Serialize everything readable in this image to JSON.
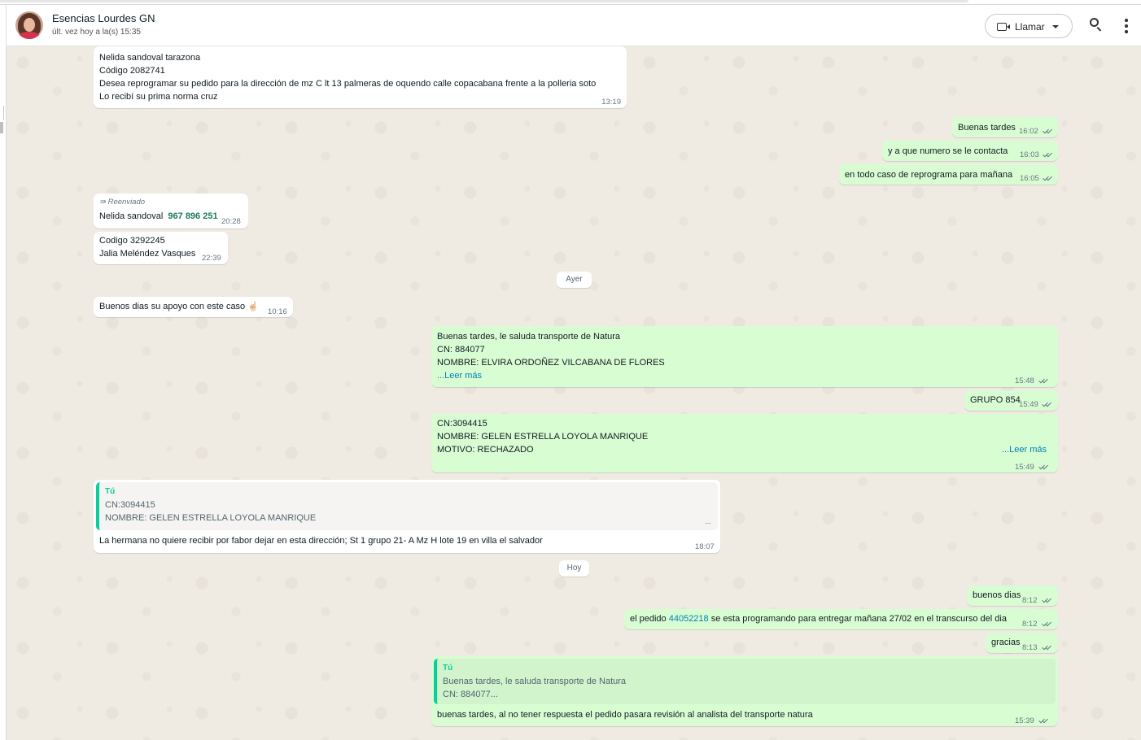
{
  "header": {
    "contact_name": "Esencias Lourdes GN",
    "status": "últ. vez hoy a la(s) 15:35",
    "call_label": "Llamar",
    "icons": [
      "video-icon",
      "chevron-down-icon",
      "search-icon",
      "menu-icon"
    ]
  },
  "messages": [
    {
      "dir": "in",
      "lines": [
        "Nelida sandoval tarazona",
        "Código 2082741",
        "Desea reprogramar su pedido para la dirección de  mz C lt 13 palmeras de oquendo calle copacabana frente a la polleria soto",
        "Lo recibí su prima norma cruz"
      ],
      "time": "13:19"
    },
    {
      "dir": "out",
      "text": "Buenas tardes",
      "time": "16:02"
    },
    {
      "dir": "out",
      "text": "y  a que numero  se le contacta",
      "time": "16:03"
    },
    {
      "dir": "out",
      "text": "en todo caso de reprograma para mañana",
      "time": "16:05"
    },
    {
      "dir": "in",
      "forwarded": "Reenviado",
      "text": "Nelida sandoval",
      "phone": "967 896 251",
      "time": "20:28"
    },
    {
      "dir": "in",
      "lines": [
        "Codigo 3292245",
        "Jalia Meléndez Vasques"
      ],
      "time": "22:39"
    },
    {
      "dir": "in",
      "text": "Buenos dias su apoyo con este caso",
      "emoji": "☝🏻",
      "time": "10:16"
    },
    {
      "dir": "out",
      "lines": [
        "Buenas tardes, le saluda transporte de Natura",
        "CN: 884077",
        "NOMBRE:  ELVIRA ORDOÑEZ VILCABANA DE FLORES"
      ],
      "read_more": "...Leer más",
      "time": "15:48"
    },
    {
      "dir": "out",
      "text": "GRUPO 854",
      "time": "15:49"
    },
    {
      "dir": "out",
      "lines": [
        "CN:3094415",
        "NOMBRE:  GELEN ESTRELLA LOYOLA MANRIQUE",
        "MOTIVO: RECHAZADO"
      ],
      "read_more": "...Leer más",
      "time": "15:49"
    },
    {
      "dir": "in",
      "quote": {
        "author": "Tú",
        "lines": [
          "CN:3094415",
          "NOMBRE:  GELEN ESTRELLA LOYOLA MANRIQUE"
        ],
        "ellipsis": "..."
      },
      "text": "La hermana no quiere recibir por fabor dejar en esta dirección; St 1 grupo 21- A Mz H lote 19 en villa el salvador",
      "time": "18:07"
    },
    {
      "dir": "out",
      "text": "buenos dias",
      "time": "8:12"
    },
    {
      "dir": "out",
      "text_before": "el pedido ",
      "order": "44052218",
      "text_after": " se esta programando para entregar mañana 27/02 en el transcurso del dia",
      "time": "8:12"
    },
    {
      "dir": "out",
      "text": "gracias",
      "time": "8:13"
    },
    {
      "dir": "out",
      "quote": {
        "author": "Tú",
        "lines": [
          "Buenas tardes, le saluda transporte de Natura",
          "CN: 884077..."
        ]
      },
      "text": "buenas tardes,  al no tener respuesta  el pedido pasara revisión al analista del transporte natura",
      "time": "15:39"
    }
  ],
  "date_dividers": [
    "Ayer",
    "Hoy"
  ]
}
